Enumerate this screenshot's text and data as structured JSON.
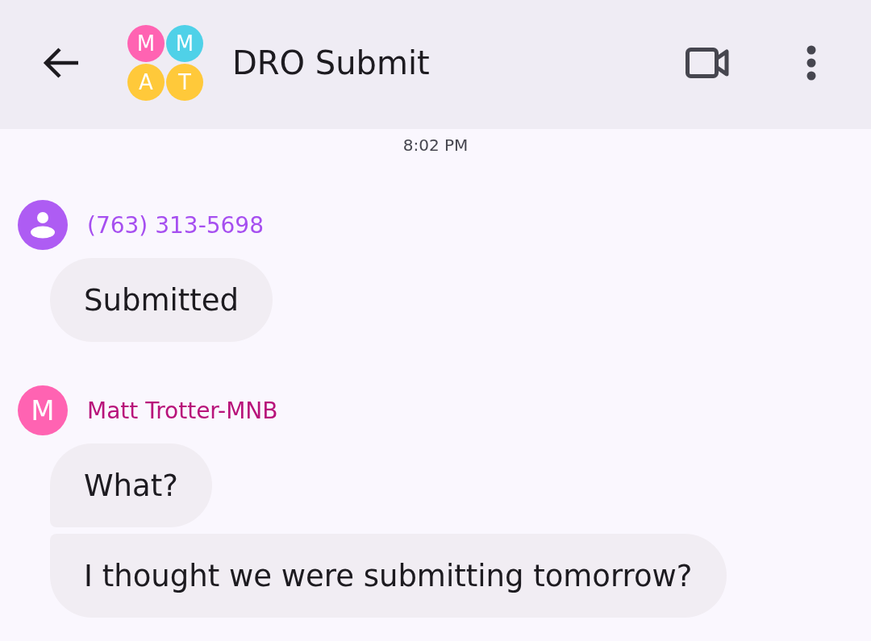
{
  "header": {
    "title": "DRO Submit",
    "group_avatar": [
      {
        "letter": "M",
        "color": "#ff63b2"
      },
      {
        "letter": "M",
        "color": "#4fd1e8"
      },
      {
        "letter": "A",
        "color": "#ffc93a"
      },
      {
        "letter": "T",
        "color": "#ffc93a"
      }
    ]
  },
  "timestamp": "8:02 PM",
  "message_groups": [
    {
      "sender": {
        "text": "(763) 313-5698",
        "color": "#a64ff0"
      },
      "avatar": {
        "kind": "person",
        "color": "#ae5cf3"
      },
      "messages": [
        "Submitted"
      ]
    },
    {
      "sender": {
        "text": "Matt Trotter-MNB",
        "color": "#b8137a"
      },
      "avatar": {
        "kind": "initial",
        "letter": "M",
        "color": "#ff63b2"
      },
      "messages": [
        "What?",
        "I thought we were submitting tomorrow?"
      ]
    }
  ]
}
